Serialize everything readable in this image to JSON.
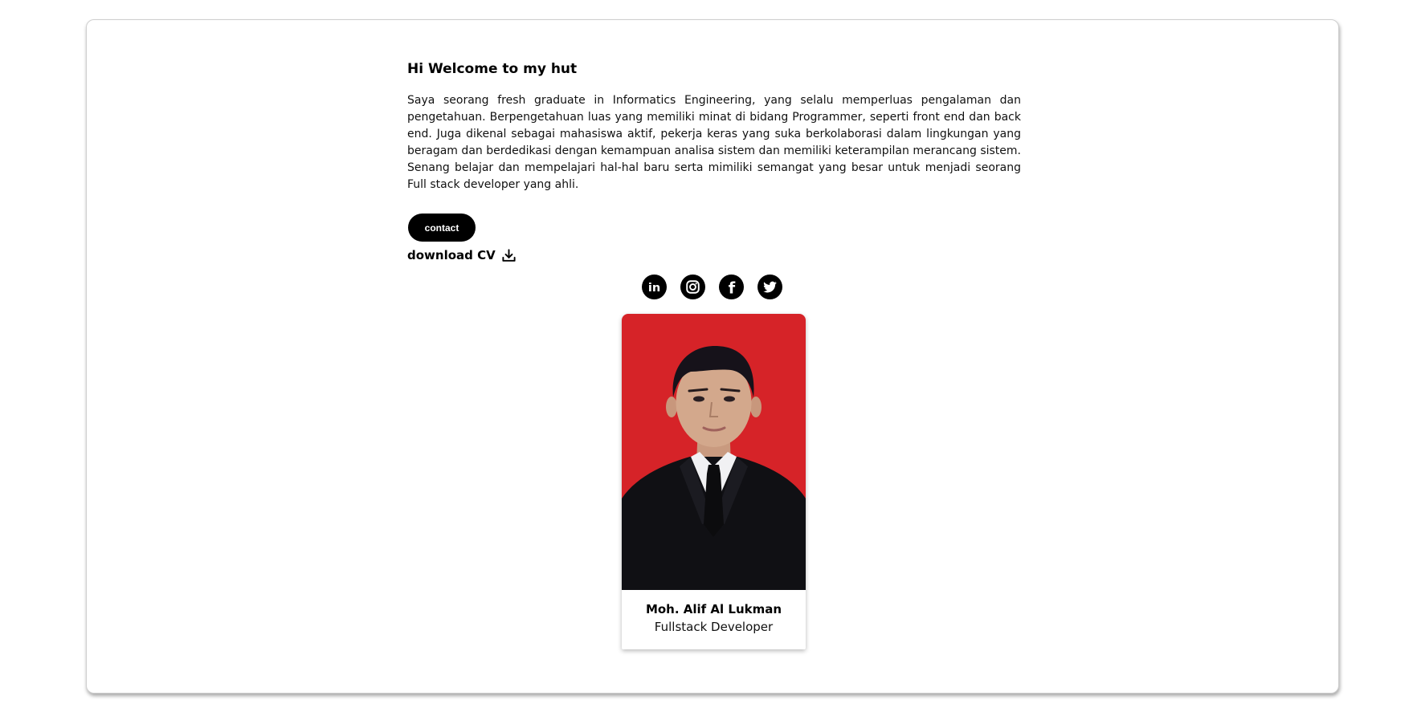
{
  "hero": {
    "title": "Hi Welcome to my hut",
    "description": "Saya seorang fresh graduate in Informatics Engineering, yang selalu memperluas pengalaman dan pengetahuan. Berpengetahuan luas yang memiliki minat di bidang Programmer, seperti front end dan back end. Juga dikenal sebagai mahasiswa aktif, pekerja keras yang suka berkolaborasi dalam lingkungan yang beragam dan berdedikasi dengan kemampuan analisa sistem dan memiliki keterampilan merancang sistem. Senang belajar dan mempelajari hal-hal baru serta mimiliki semangat yang besar untuk menjadi seorang Full stack developer yang ahli.",
    "contact_label": "contact",
    "download_label": "download CV",
    "download_icon": "download-icon"
  },
  "socials": [
    {
      "icon": "linkedin-icon",
      "glyph": "in"
    },
    {
      "icon": "instagram-icon"
    },
    {
      "icon": "facebook-icon",
      "glyph": "f"
    },
    {
      "icon": "twitter-icon"
    }
  ],
  "profile": {
    "name": "Moh. Alif Al Lukman",
    "role": "Fullstack Developer",
    "photo_background": "#d62328",
    "suit_color": "#101014"
  },
  "colors": {
    "accent": "#000000",
    "background": "#ffffff"
  }
}
